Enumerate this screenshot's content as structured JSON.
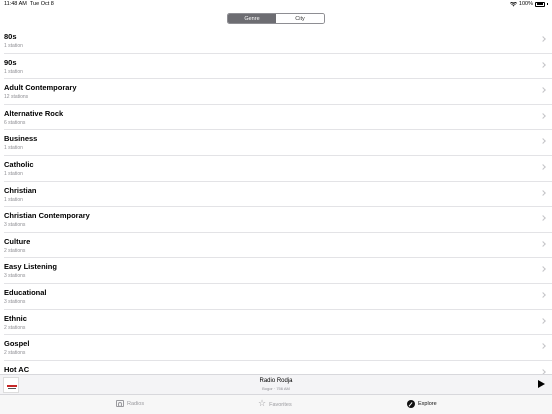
{
  "status_bar": {
    "time": "11:48 AM",
    "date": "Tue Oct 8",
    "battery": "100%"
  },
  "segmented_control": {
    "segments": [
      "Genre",
      "City"
    ],
    "selected": "Genre"
  },
  "genres": [
    {
      "name": "80s",
      "count": "1 station"
    },
    {
      "name": "90s",
      "count": "1 station"
    },
    {
      "name": "Adult Contemporary",
      "count": "12 stations"
    },
    {
      "name": "Alternative Rock",
      "count": "6 stations"
    },
    {
      "name": "Business",
      "count": "1 station"
    },
    {
      "name": "Catholic",
      "count": "1 station"
    },
    {
      "name": "Christian",
      "count": "1 station"
    },
    {
      "name": "Christian Contemporary",
      "count": "3 stations"
    },
    {
      "name": "Culture",
      "count": "2 stations"
    },
    {
      "name": "Easy Listening",
      "count": "3 stations"
    },
    {
      "name": "Educational",
      "count": "3 stations"
    },
    {
      "name": "Ethnic",
      "count": "2 stations"
    },
    {
      "name": "Gospel",
      "count": "2 stations"
    },
    {
      "name": "Hot AC",
      "count": ""
    }
  ],
  "now_playing": {
    "title": "Radio Rodja",
    "subtitle": "Bogor · 756 AM"
  },
  "tab_bar": {
    "tabs": [
      {
        "label": "Radios",
        "icon": "radio-icon"
      },
      {
        "label": "Favorites",
        "icon": "star-icon"
      },
      {
        "label": "Explore",
        "icon": "compass-icon"
      }
    ],
    "selected": "Explore"
  }
}
